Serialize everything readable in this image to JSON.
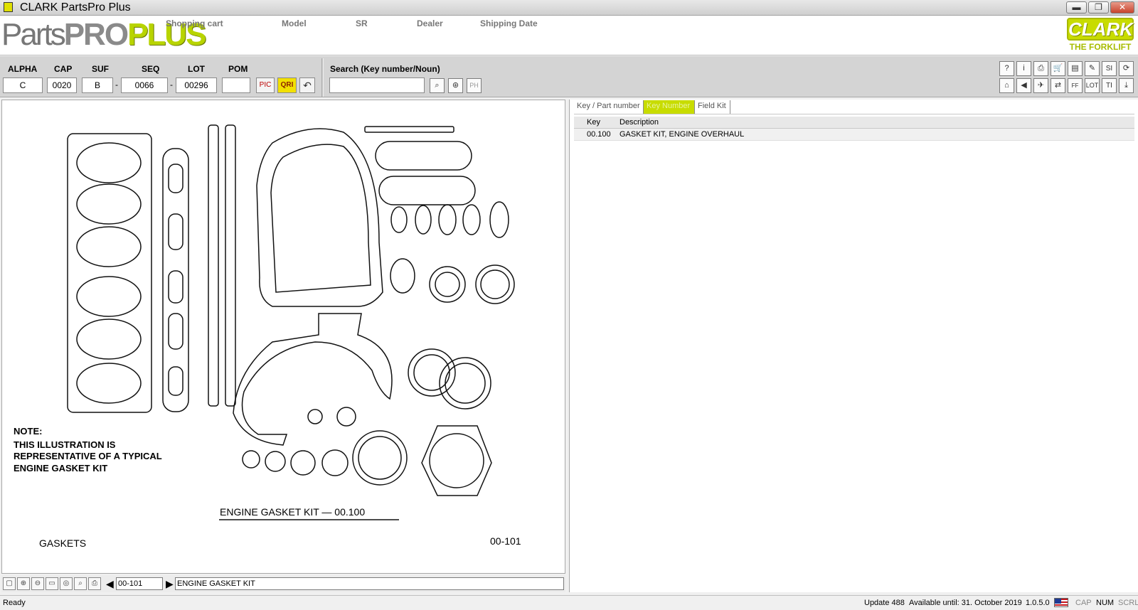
{
  "window": {
    "title": "CLARK PartsPro Plus",
    "buttons": {
      "minimize": "▬",
      "restore": "❐",
      "close": "✕"
    }
  },
  "header": {
    "logo": {
      "parts": "Parts",
      "pro": "PRO",
      "plus": "PLUS"
    },
    "labels": {
      "shopping_cart": "Shopping cart",
      "model": "Model",
      "sr": "SR",
      "dealer": "Dealer",
      "shipping_date": "Shipping Date"
    },
    "brand": {
      "name": "CLARK",
      "tagline": "THE FORKLIFT"
    }
  },
  "toolbar": {
    "fields": {
      "alpha": {
        "label": "ALPHA",
        "value": "C"
      },
      "cap": {
        "label": "CAP",
        "value": "0020"
      },
      "suf": {
        "label": "SUF",
        "value": "B"
      },
      "seq": {
        "label": "SEQ",
        "value": "0066"
      },
      "lot": {
        "label": "LOT",
        "value": "00296"
      },
      "pom": {
        "label": "POM",
        "value": ""
      }
    },
    "separator": "-",
    "buttons": {
      "pic": "PIC",
      "qri": "QRI",
      "back": "↶"
    },
    "search": {
      "label": "Search (Key number/Noun)",
      "value": "",
      "ph_button": "PH"
    },
    "icons_row1": [
      "?",
      "i",
      "⎙",
      "🛒",
      "▤",
      "✎",
      "SI",
      "⟳"
    ],
    "icons_row2": [
      "⌂",
      "◀",
      "✈",
      "⇄",
      "FF",
      "LOT",
      "TI",
      "⤓"
    ]
  },
  "illustration": {
    "note_heading": "NOTE:",
    "note_lines": [
      "THIS ILLUSTRATION IS",
      "REPRESENTATIVE OF A TYPICAL",
      "ENGINE  GASKET  KIT"
    ],
    "caption": "ENGINE  GASKET  KIT — 00.100",
    "section": "GASKETS",
    "figure_number": "00-101"
  },
  "nav": {
    "icons": [
      "▢",
      "⊕",
      "⊖",
      "▭",
      "◎",
      "⌕",
      "⎙"
    ],
    "page_value": "00-101",
    "page_title": "ENGINE GASKET KIT"
  },
  "right": {
    "tabs": [
      "Key / Part number",
      "Key Number",
      "Field Kit"
    ],
    "active_tab": "Key Number",
    "columns": {
      "key": "Key",
      "description": "Description"
    },
    "rows": [
      {
        "key": "00.100",
        "description": "GASKET KIT, ENGINE OVERHAUL"
      }
    ]
  },
  "status": {
    "left": "Ready",
    "update": "Update 488",
    "available": "Available until: 31. October 2019",
    "version": "1.0.5.0",
    "cap": "CAP",
    "num": "NUM",
    "scrl": "SCRL"
  },
  "colors": {
    "accent_green": "#c8dc00",
    "qri_yellow": "#f2e000",
    "close_red": "#c8432c"
  }
}
